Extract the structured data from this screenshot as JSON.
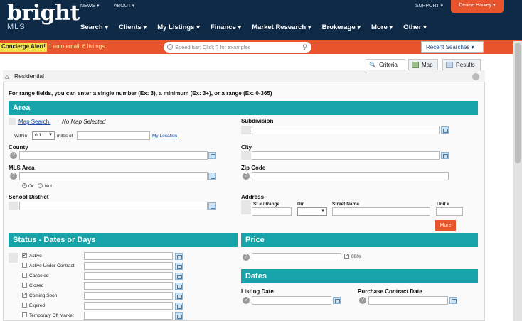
{
  "brand": {
    "name": "bright",
    "sub": "MLS"
  },
  "top_links": {
    "news": "NEWS ▾",
    "about": "ABOUT ▾",
    "support": "SUPPORT ▾",
    "user": "Denise Harvey ▾"
  },
  "nav": [
    "Search ▾",
    "Clients ▾",
    "My Listings ▾",
    "Finance ▾",
    "Market Research ▾",
    "Brokerage ▾",
    "More ▾",
    "Other ▾"
  ],
  "alert": {
    "label": "Concierge Alert!",
    "text": "1 auto email, 6 listings"
  },
  "speedbar": {
    "placeholder": "Speed bar: Click ? for examples"
  },
  "recent_searches": "Recent Searches ▾",
  "tabs": {
    "criteria": "Criteria",
    "map": "Map",
    "results": "Results"
  },
  "breadcrumb": "Residential",
  "range_note": "For range fields, you can enter a single number (Ex: 3), a minimum (Ex: 3+), or a range (Ex: 0-365)",
  "area": {
    "title": "Area",
    "map_search_link": "Map Search:",
    "map_status": "No Map Selected",
    "within_label": "Within",
    "within_value": "0.1",
    "miles_label": "miles of",
    "my_location_link": "My Location",
    "county": "County",
    "mls_area": "MLS Area",
    "or_label": "Or",
    "not_label": "Not",
    "school_district": "School District",
    "subdivision": "Subdivision",
    "city": "City",
    "zip_code": "Zip Code",
    "address": "Address",
    "street_no_range": "St # / Range",
    "dir": "Dir",
    "street_name": "Street Name",
    "unit": "Unit #",
    "more_button": "More"
  },
  "status": {
    "title": "Status - Dates or Days",
    "items": [
      {
        "label": "Active",
        "checked": true
      },
      {
        "label": "Active Under Contract",
        "checked": false
      },
      {
        "label": "Canceled",
        "checked": false
      },
      {
        "label": "Closed",
        "checked": false
      },
      {
        "label": "Coming Soon",
        "checked": true
      },
      {
        "label": "Expired",
        "checked": false
      },
      {
        "label": "Temporary Off Market",
        "checked": false
      }
    ]
  },
  "price": {
    "title": "Price",
    "units_label": "000s"
  },
  "dates": {
    "title": "Dates",
    "listing_date": "Listing Date",
    "purchase_contract_date": "Purchase Contract Date"
  },
  "colors": {
    "nav_bg": "#0e2a47",
    "accent_orange": "#e8542b",
    "section_teal": "#16a3aa",
    "alert_yellow": "#f1e24c"
  }
}
